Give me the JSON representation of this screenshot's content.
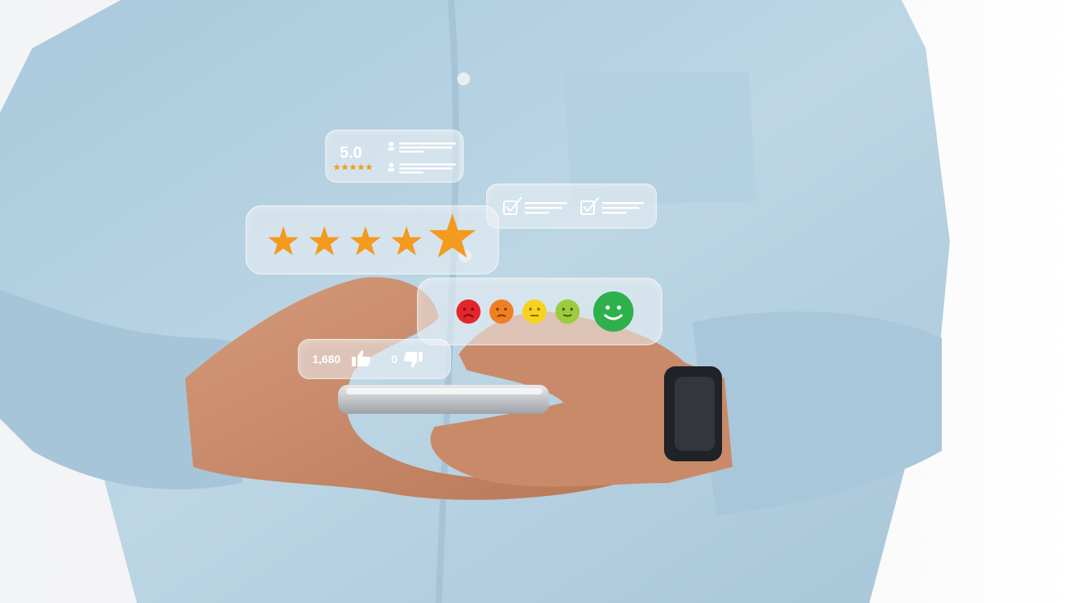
{
  "rating_card": {
    "value": "5.0",
    "icon": "mini-stars-icon"
  },
  "checklist_card": {
    "icons": [
      "checkbox-icon",
      "checkbox-icon"
    ]
  },
  "stars_card": {
    "rating": 5,
    "max": 5,
    "star_color": "#f39a1f",
    "icon": "star-icon"
  },
  "feedback_card": {
    "faces": [
      {
        "icon": "very-sad-face-icon",
        "color": "#e3262b"
      },
      {
        "icon": "sad-face-icon",
        "color": "#f07f21"
      },
      {
        "icon": "neutral-face-icon",
        "color": "#f7d21e"
      },
      {
        "icon": "slight-smile-face-icon",
        "color": "#9ccc3b"
      },
      {
        "icon": "happy-face-icon",
        "color": "#2eb04c"
      }
    ],
    "selected": "happy-face-icon"
  },
  "votes_card": {
    "likes": "1,680",
    "dislikes": "0",
    "like_icon": "thumbs-up-icon",
    "dislike_icon": "thumbs-down-icon"
  }
}
